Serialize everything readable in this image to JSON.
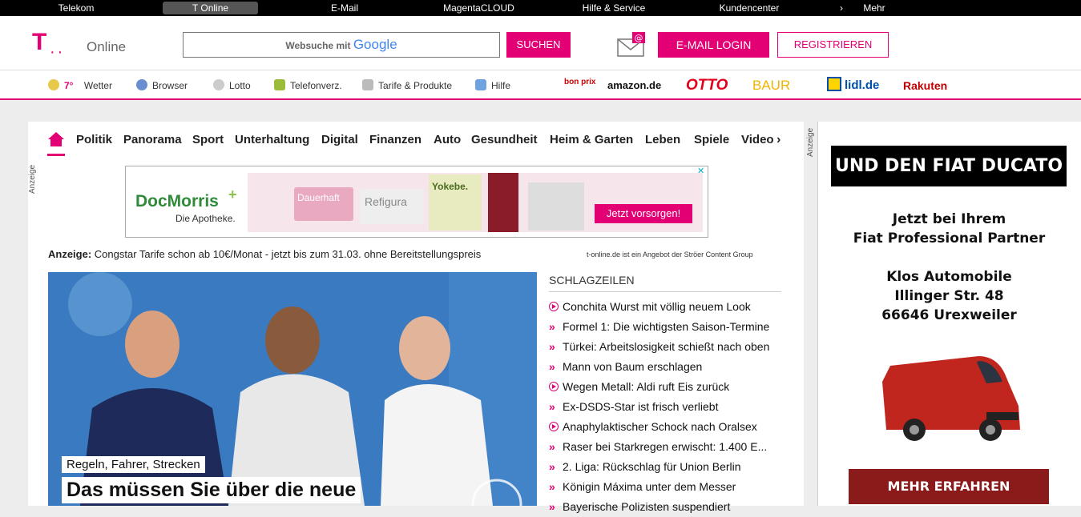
{
  "topbar": {
    "items": [
      "Telekom",
      "T Online",
      "E-Mail",
      "MagentaCLOUD",
      "Hilfe & Service",
      "Kundencenter",
      "Mehr"
    ]
  },
  "header": {
    "logo_text": "Online",
    "search_prefix": "Websuche mit",
    "search_brand": "Google",
    "search_button": "SUCHEN",
    "email_login": "E-MAIL LOGIN",
    "register": "REGISTRIEREN"
  },
  "subnav": {
    "weather_temp": "7°",
    "items": [
      "Wetter",
      "Browser",
      "Lotto",
      "Telefonverz.",
      "Tarife & Produkte",
      "Hilfe"
    ],
    "brands": [
      "bon prix",
      "amazon.de",
      "OTTO",
      "BAUR",
      "lidl.de",
      "Rakuten"
    ]
  },
  "categories": [
    "Politik",
    "Panorama",
    "Sport",
    "Unterhaltung",
    "Digital",
    "Finanzen",
    "Auto",
    "Gesundheit",
    "Heim & Garten",
    "Leben",
    "Spiele",
    "Video"
  ],
  "ad_banner": {
    "label": "Anzeige",
    "brand": "DocMorris",
    "brand_sub": "Die Apotheke.",
    "cta": "Jetzt vorsorgen!",
    "product1": "Dauerhaft",
    "product2": "Refigura",
    "product3": "Yokebe."
  },
  "ad_line": {
    "prefix": "Anzeige:",
    "text": "Congstar Tarife schon ab 10€/Monat - jetzt bis zum 31.03. ohne Bereitstellungspreis"
  },
  "stroer_note": "t-online.de ist ein Angebot der Ströer Content Group",
  "hero": {
    "kicker": "Regeln, Fahrer, Strecken",
    "headline": "Das müssen Sie über die neue"
  },
  "headlines": {
    "title": "SCHLAGZEILEN",
    "items": [
      {
        "text": "Conchita Wurst mit völlig neuem Look",
        "video": true
      },
      {
        "text": "Formel 1: Die wichtigsten Saison-Termine",
        "video": false
      },
      {
        "text": "Türkei: Arbeitslosigkeit schießt nach oben",
        "video": false
      },
      {
        "text": "Mann von Baum erschlagen",
        "video": false
      },
      {
        "text": "Wegen Metall: Aldi ruft Eis zurück",
        "video": true
      },
      {
        "text": "Ex-DSDS-Star ist frisch verliebt",
        "video": false
      },
      {
        "text": "Anaphylaktischer Schock nach Oralsex",
        "video": true
      },
      {
        "text": "Raser bei Starkregen erwischt: 1.400 E...",
        "video": false
      },
      {
        "text": "2. Liga: Rückschlag für Union Berlin",
        "video": false
      },
      {
        "text": "Königin Máxima unter dem Messer",
        "video": false
      },
      {
        "text": "Bayerische Polizisten suspendiert",
        "video": false
      }
    ]
  },
  "right_ad": {
    "label": "Anzeige",
    "banner": "UND DEN FIAT DUCATO",
    "line1": "Jetzt bei Ihrem",
    "line2": "Fiat Professional Partner",
    "dealer1": "Klos Automobile",
    "dealer2": "Illinger Str. 48",
    "dealer3": "66646 Urexweiler",
    "cta": "MEHR ERFAHREN"
  },
  "colors": {
    "accent": "#e20074",
    "topbar": "#000000",
    "cta_red": "#8b1a1a"
  }
}
